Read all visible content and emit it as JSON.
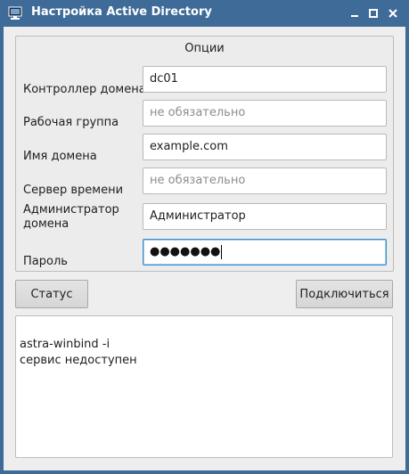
{
  "window": {
    "title": "Настройка Active Directory",
    "colors": {
      "titlebar": "#3f6b98",
      "focus_border": "#3e8ecd"
    }
  },
  "options": {
    "group_title": "Опции",
    "fields": [
      {
        "label": "Контроллер домена",
        "value": "dc01",
        "placeholder": ""
      },
      {
        "label": "Рабочая группа",
        "value": "",
        "placeholder": "не обязательно"
      },
      {
        "label": "Имя домена",
        "value": "example.com",
        "placeholder": ""
      },
      {
        "label": "Сервер времени",
        "value": "",
        "placeholder": "не обязательно"
      },
      {
        "label_line1": "Администратор",
        "label_line2": "домена",
        "value": "Администратор",
        "placeholder": ""
      },
      {
        "label": "Пароль",
        "masked_value": "●●●●●●●"
      }
    ]
  },
  "buttons": {
    "status": "Статус",
    "connect": "Подключиться"
  },
  "output": {
    "lines": [
      "astra-winbind -i",
      "сервис недоступен"
    ]
  },
  "icons": {
    "app": "computer-monitor-icon",
    "minimize": "minimize-icon",
    "maximize": "maximize-icon",
    "close": "close-icon"
  }
}
